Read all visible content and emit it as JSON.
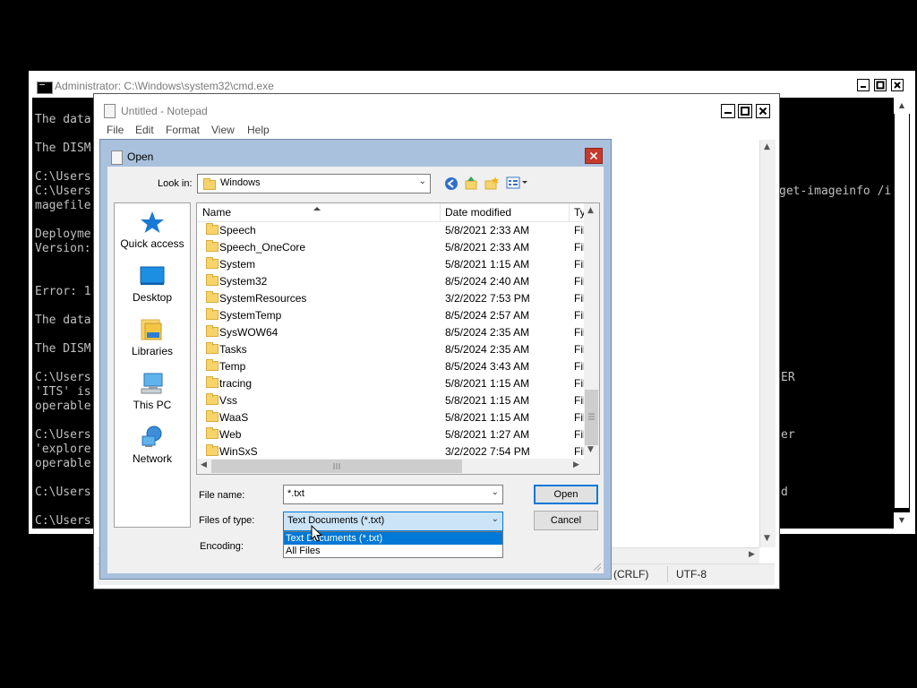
{
  "cmd": {
    "title": "Administrator: C:\\Windows\\system32\\cmd.exe",
    "lines_left": [
      "The data",
      "",
      "The DISM",
      "",
      "C:\\Users",
      "C:\\Users",
      "magefile",
      "",
      "Deployme",
      "Version:",
      "",
      "",
      "Error: 1",
      "",
      "The data",
      "",
      "The DISM",
      "",
      "C:\\Users",
      "'ITS' is",
      "operable",
      "",
      "C:\\Users",
      "'explore",
      "operable",
      "",
      "C:\\Users",
      "",
      "C:\\Users"
    ],
    "lines_right": [
      {
        "row": 5,
        "text": "get-imageinfo /i"
      },
      {
        "row": 18,
        "text": "ER"
      },
      {
        "row": 22,
        "text": "er"
      },
      {
        "row": 26,
        "text": "d"
      }
    ]
  },
  "notepad": {
    "title": "Untitled - Notepad",
    "menus": [
      "File",
      "Edit",
      "Format",
      "View",
      "Help"
    ],
    "status": {
      "line_ending": "(CRLF)",
      "encoding": "UTF-8"
    }
  },
  "dialog": {
    "title": "Open",
    "look_in_label": "Look in:",
    "look_in_value": "Windows",
    "places": [
      "Quick access",
      "Desktop",
      "Libraries",
      "This PC",
      "Network"
    ],
    "columns": [
      "Name",
      "Date modified",
      "Ty"
    ],
    "files": [
      {
        "name": "Speech",
        "date": "5/8/2021 2:33 AM",
        "type": "Fil"
      },
      {
        "name": "Speech_OneCore",
        "date": "5/8/2021 2:33 AM",
        "type": "Fil"
      },
      {
        "name": "System",
        "date": "5/8/2021 1:15 AM",
        "type": "Fil"
      },
      {
        "name": "System32",
        "date": "8/5/2024 2:40 AM",
        "type": "Fil"
      },
      {
        "name": "SystemResources",
        "date": "3/2/2022 7:53 PM",
        "type": "Fil"
      },
      {
        "name": "SystemTemp",
        "date": "8/5/2024 2:57 AM",
        "type": "Fil"
      },
      {
        "name": "SysWOW64",
        "date": "8/5/2024 2:35 AM",
        "type": "Fil"
      },
      {
        "name": "Tasks",
        "date": "8/5/2024 2:35 AM",
        "type": "Fil"
      },
      {
        "name": "Temp",
        "date": "8/5/2024 3:43 AM",
        "type": "Fil"
      },
      {
        "name": "tracing",
        "date": "5/8/2021 1:15 AM",
        "type": "Fil"
      },
      {
        "name": "Vss",
        "date": "5/8/2021 1:15 AM",
        "type": "Fil"
      },
      {
        "name": "WaaS",
        "date": "5/8/2021 1:15 AM",
        "type": "Fil"
      },
      {
        "name": "Web",
        "date": "5/8/2021 1:27 AM",
        "type": "Fil"
      },
      {
        "name": "WinSxS",
        "date": "3/2/2022 7:54 PM",
        "type": "Fil"
      }
    ],
    "file_name_label": "File name:",
    "file_name_value": "*.txt",
    "files_of_type_label": "Files of type:",
    "files_of_type_value": "Text Documents (*.txt)",
    "encoding_label": "Encoding:",
    "type_options": [
      "Text Documents (*.txt)",
      "All Files"
    ],
    "open_button": "Open",
    "cancel_button": "Cancel"
  },
  "colors": {
    "dialog_frame": "#a9c1dd",
    "close_button": "#c6392b",
    "selection": "#0078d7",
    "console_bg": "#000000",
    "console_text": "#c0c0c0"
  }
}
